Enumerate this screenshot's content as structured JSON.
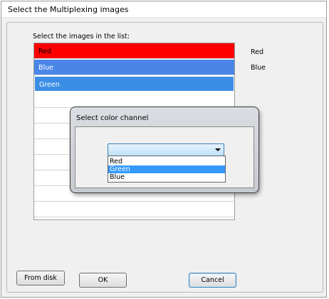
{
  "window": {
    "title": "Select the Multiplexing images"
  },
  "list": {
    "caption": "Select the images in the list:",
    "rows": [
      {
        "label": "Red",
        "color": "#ff0000"
      },
      {
        "label": "Blue",
        "color": "#4a86e8"
      },
      {
        "label": "Green",
        "color": "#3b8ee6"
      }
    ]
  },
  "side_labels": [
    "Red",
    "Blue"
  ],
  "buttons": {
    "from_disk": "From disk",
    "ok": "OK",
    "cancel": "Cancel"
  },
  "dialog": {
    "title": "Select color channel",
    "combo_value": "",
    "options": [
      "Red",
      "Green",
      "Blue"
    ],
    "highlighted_option": "Green"
  }
}
